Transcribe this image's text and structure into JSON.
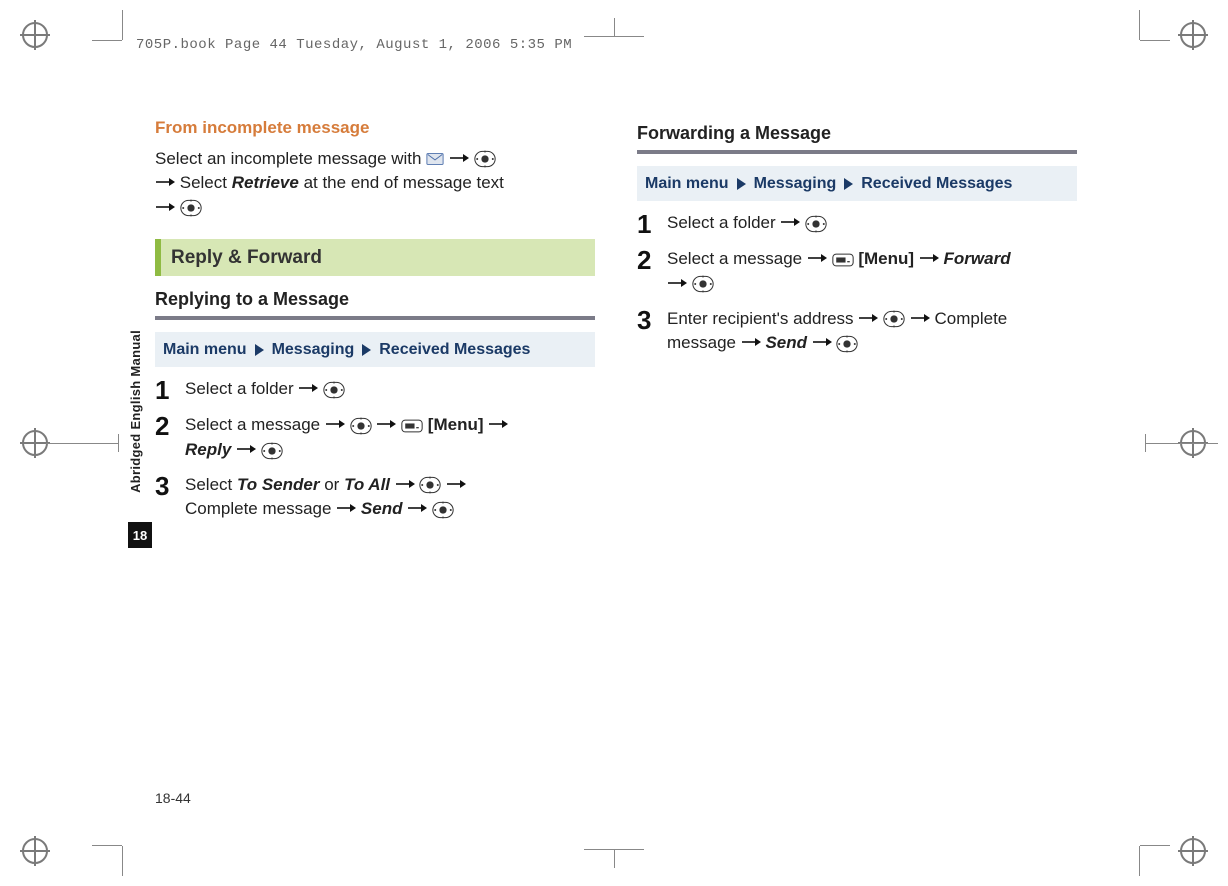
{
  "stamp": "705P.book  Page 44  Tuesday, August 1, 2006  5:35 PM",
  "sideTab": "Abridged English Manual",
  "sideChapter": "18",
  "footerPage": "18-44",
  "left": {
    "incomplete": {
      "title": "From incomplete message",
      "line1_a": "Select an incomplete message with ",
      "line2_a": " Select ",
      "retrieve": "Retrieve",
      "line2_b": " at the end of message text"
    },
    "section": "Reply & Forward",
    "replyHeading": "Replying to a Message",
    "breadcrumb": {
      "a": "Main menu",
      "b": "Messaging",
      "c": "Received Messages"
    },
    "steps": {
      "1": {
        "t": "Select a folder "
      },
      "2": {
        "a": "Select a message ",
        "menu": "[Menu]",
        "reply": "Reply"
      },
      "3": {
        "a": "Select ",
        "toSender": "To Sender",
        "or": " or ",
        "toAll": "To All",
        "b": "Complete message ",
        "send": "Send"
      }
    }
  },
  "right": {
    "heading": "Forwarding a Message",
    "breadcrumb": {
      "a": "Main menu",
      "b": "Messaging",
      "c": "Received Messages"
    },
    "steps": {
      "1": {
        "t": "Select a folder "
      },
      "2": {
        "a": "Select a message ",
        "menu": "[Menu]",
        "fwd": "Forward"
      },
      "3": {
        "a": "Enter recipient's address ",
        "b": " Complete message ",
        "send": "Send"
      }
    }
  }
}
